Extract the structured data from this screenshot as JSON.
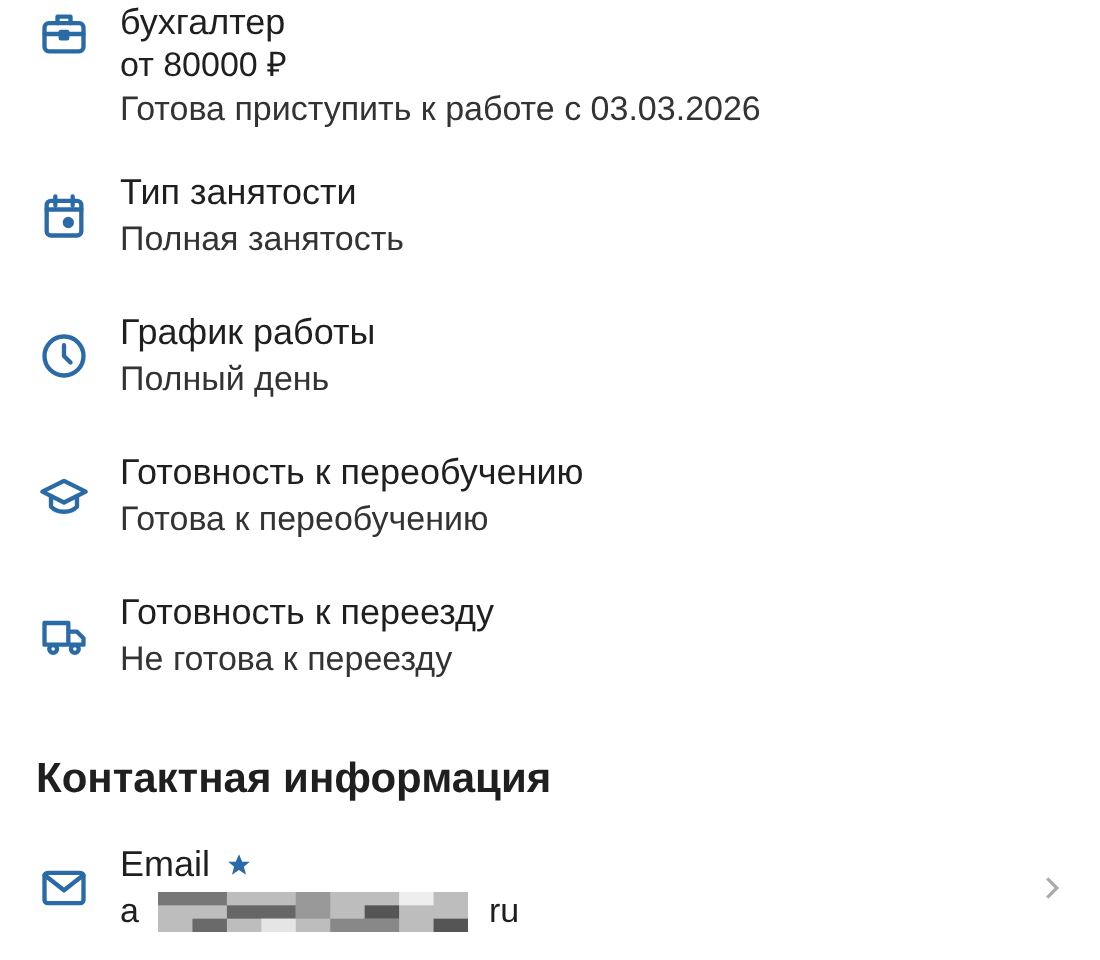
{
  "position": {
    "kind": "briefcase",
    "title": "бухгалтер",
    "salary": "от 80000 ₽",
    "availability": "Готова приступить к работе с 03.03.2026"
  },
  "details": [
    {
      "kind": "calendar",
      "label": "Тип занятости",
      "value": "Полная занятость"
    },
    {
      "kind": "clock",
      "label": "График работы",
      "value": "Полный день"
    },
    {
      "kind": "cap",
      "label": "Готовность к переобучению",
      "value": "Готова к переобучению"
    },
    {
      "kind": "truck",
      "label": "Готовность к переезду",
      "value": "Не готова к переезду"
    }
  ],
  "contacts": {
    "heading": "Контактная информация",
    "items": [
      {
        "kind": "mail",
        "label": "Email",
        "preferred": true,
        "value_start": "a",
        "value_end": "ru"
      }
    ]
  }
}
